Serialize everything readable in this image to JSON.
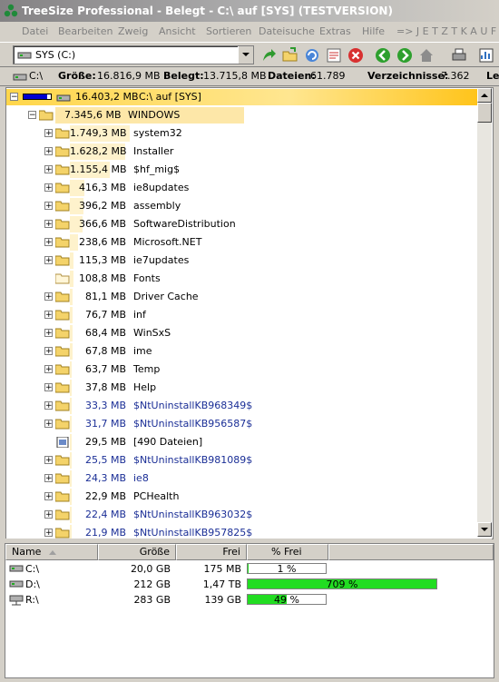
{
  "titlebar": {
    "title": "TreeSize Professional - Belegt - C:\\  auf [SYS] (TESTVERSION)"
  },
  "menu": [
    {
      "label": "Datei"
    },
    {
      "label": "Bearbeiten"
    },
    {
      "label": "Zweig"
    },
    {
      "label": "Ansicht"
    },
    {
      "label": "Sortieren"
    },
    {
      "label": "Dateisuche"
    },
    {
      "label": "Extras"
    },
    {
      "label": "Hilfe"
    },
    {
      "label": "=> J E T Z T  K A U F E"
    }
  ],
  "toolbar": {
    "drive_value": "SYS (C:)"
  },
  "infobar": {
    "path": "C:\\",
    "size_label": "Größe:",
    "size_value": "16.816,9 MB",
    "used_label": "Belegt:",
    "used_value": "13.715,8 MB",
    "files_label": "Dateien:",
    "files_value": "61.789",
    "dirs_label": "Verzeichnisse:",
    "dirs_value": "7.362",
    "extra": "Le"
  },
  "tree": {
    "root": {
      "size": "16.403,2 MB",
      "name": "C:\\  auf [SYS]"
    },
    "windows": {
      "size": "7.345,6 MB",
      "name": "WINDOWS"
    },
    "items": [
      {
        "size": "1.749,3 MB",
        "name": "system32",
        "expandable": true,
        "blue": false,
        "icon": "folder"
      },
      {
        "size": "1.628,2 MB",
        "name": "Installer",
        "expandable": true,
        "blue": false,
        "icon": "folder"
      },
      {
        "size": "1.155,4 MB",
        "name": "$hf_mig$",
        "expandable": true,
        "blue": false,
        "icon": "folder"
      },
      {
        "size": "416,3 MB",
        "name": "ie8updates",
        "expandable": true,
        "blue": false,
        "icon": "folder"
      },
      {
        "size": "396,2 MB",
        "name": "assembly",
        "expandable": true,
        "blue": false,
        "icon": "folder"
      },
      {
        "size": "366,6 MB",
        "name": "SoftwareDistribution",
        "expandable": true,
        "blue": false,
        "icon": "folder"
      },
      {
        "size": "238,6 MB",
        "name": "Microsoft.NET",
        "expandable": true,
        "blue": false,
        "icon": "folder"
      },
      {
        "size": "115,3 MB",
        "name": "ie7updates",
        "expandable": true,
        "blue": false,
        "icon": "folder"
      },
      {
        "size": "108,8 MB",
        "name": "Fonts",
        "expandable": false,
        "blue": false,
        "icon": "folder-open"
      },
      {
        "size": "81,1 MB",
        "name": "Driver Cache",
        "expandable": true,
        "blue": false,
        "icon": "folder"
      },
      {
        "size": "76,7 MB",
        "name": "inf",
        "expandable": true,
        "blue": false,
        "icon": "folder"
      },
      {
        "size": "68,4 MB",
        "name": "WinSxS",
        "expandable": true,
        "blue": false,
        "icon": "folder"
      },
      {
        "size": "67,8 MB",
        "name": "ime",
        "expandable": true,
        "blue": false,
        "icon": "folder"
      },
      {
        "size": "63,7 MB",
        "name": "Temp",
        "expandable": true,
        "blue": false,
        "icon": "folder"
      },
      {
        "size": "37,8 MB",
        "name": "Help",
        "expandable": true,
        "blue": false,
        "icon": "folder"
      },
      {
        "size": "33,3 MB",
        "name": "$NtUninstallKB968349$",
        "expandable": true,
        "blue": true,
        "icon": "folder"
      },
      {
        "size": "31,7 MB",
        "name": "$NtUninstallKB956587$",
        "expandable": true,
        "blue": true,
        "icon": "folder"
      },
      {
        "size": "29,5 MB",
        "name": "[490 Dateien]",
        "expandable": false,
        "blue": false,
        "icon": "files"
      },
      {
        "size": "25,5 MB",
        "name": "$NtUninstallKB981089$",
        "expandable": true,
        "blue": true,
        "icon": "folder"
      },
      {
        "size": "24,3 MB",
        "name": "ie8",
        "expandable": true,
        "blue": true,
        "icon": "folder"
      },
      {
        "size": "22,9 MB",
        "name": "PCHealth",
        "expandable": true,
        "blue": false,
        "icon": "folder"
      },
      {
        "size": "22,4 MB",
        "name": "$NtUninstallKB963032$",
        "expandable": true,
        "blue": true,
        "icon": "folder"
      },
      {
        "size": "21,9 MB",
        "name": "$NtUninstallKB957825$",
        "expandable": true,
        "blue": true,
        "icon": "folder"
      }
    ]
  },
  "drives": {
    "headers": {
      "name": "Name",
      "size": "Größe",
      "free": "Frei",
      "pct": "% Frei"
    },
    "rows": [
      {
        "name": "C:\\",
        "size": "20,0 GB",
        "free": "175 MB",
        "pct": "1 %",
        "pct_value": 1,
        "icon": "hdd-icon"
      },
      {
        "name": "D:\\",
        "size": "212 GB",
        "free": "1,47 TB",
        "pct": "709 %",
        "pct_value": 709,
        "icon": "hdd-icon"
      },
      {
        "name": "R:\\",
        "size": "283 GB",
        "free": "139 GB",
        "pct": "49 %",
        "pct_value": 49,
        "icon": "network-drive-icon"
      }
    ]
  }
}
